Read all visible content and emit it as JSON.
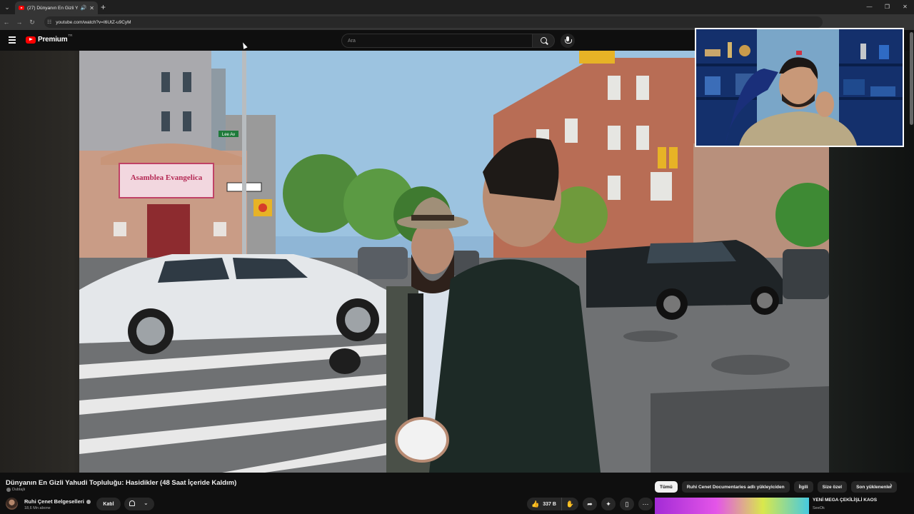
{
  "browser": {
    "tab_title": "(27) Dünyanın En Gizli Yahu...",
    "url": "youtube.com/watch?v=I6UtZ-u9CyM"
  },
  "header": {
    "logo_text": "Premium",
    "country_code": "TR",
    "search_placeholder": "Ara"
  },
  "video": {
    "title": "Dünyanın En Gizli Yahudi Topluluğu: Hasidikler (48 Saat İçeride Kaldım)",
    "dubbed_label": "Dublajlı",
    "sign_text": "Asamblea Evangelica",
    "street_sign": "Lee Av"
  },
  "channel": {
    "name": "Ruhi Çenet Belgeselleri",
    "subscribers": "18,6 Mn abone",
    "join_label": "Katıl"
  },
  "actions": {
    "likes": "337 B"
  },
  "chips": [
    {
      "label": "Tümü",
      "active": true
    },
    {
      "label": "Ruhi Cenet Documentaries adlı yükleyiciden",
      "active": false
    },
    {
      "label": "İlgili",
      "active": false
    },
    {
      "label": "Size özel",
      "active": false
    },
    {
      "label": "Son yüklenenler",
      "active": false
    }
  ],
  "recommendation": {
    "title": "YENİ MEGA ÇEKİLİŞLİ KAOS",
    "channel": "SeeOk"
  },
  "colors": {
    "brand_red": "#ff0000",
    "background": "#0f0f0f",
    "chip_bg": "#272727"
  }
}
